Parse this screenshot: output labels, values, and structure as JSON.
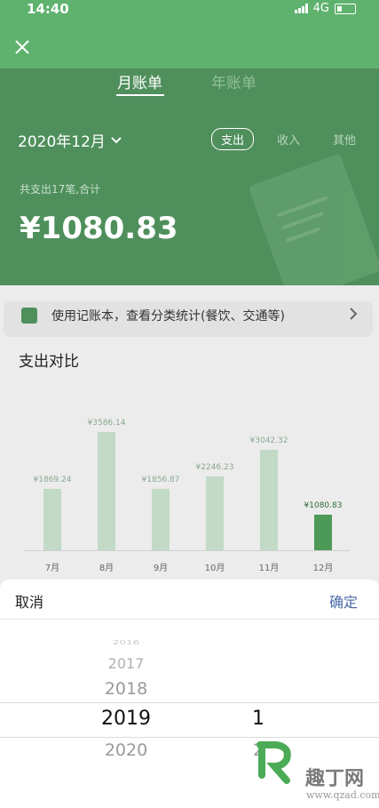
{
  "status_bar": {
    "time": "14:40",
    "network": "4G"
  },
  "tabs": [
    {
      "label": "月账单"
    },
    {
      "label": "年账单"
    }
  ],
  "month_selector": {
    "label": "2020年12月"
  },
  "type_tabs": [
    {
      "label": "支出"
    },
    {
      "label": "收入"
    },
    {
      "label": "其他"
    }
  ],
  "summary": {
    "count_text": "共支出17笔,合计",
    "total": "¥1080.83"
  },
  "tip": {
    "text": "使用记账本，查看分类统计(餐饮、交通等)"
  },
  "compare": {
    "title": "支出对比"
  },
  "chart_data": {
    "type": "bar",
    "categories": [
      "7月",
      "8月",
      "9月",
      "10月",
      "11月",
      "12月"
    ],
    "values": [
      1869.24,
      3586.14,
      1856.87,
      2246.23,
      3042.32,
      1080.83
    ],
    "data_labels": [
      "¥1869.24",
      "¥3586.14",
      "¥1856.87",
      "¥2246.23",
      "¥3042.32",
      "¥1080.83"
    ],
    "highlight_index": 5,
    "colors": {
      "bar": "#c2dac6",
      "highlight": "#4d9a58"
    }
  },
  "picker": {
    "cancel_label": "取消",
    "confirm_label": "确定",
    "years": [
      "2016",
      "2017",
      "2018",
      "2019",
      "2020"
    ],
    "months": [
      "1",
      "2"
    ],
    "selected_year": "2019",
    "selected_month": "1"
  },
  "watermark": {
    "text": "趣丁网",
    "url": "www.qzad.com"
  },
  "colors": {
    "header": "#4f8f5c",
    "accent": "#5fb26e",
    "link": "#4a6aa8"
  }
}
